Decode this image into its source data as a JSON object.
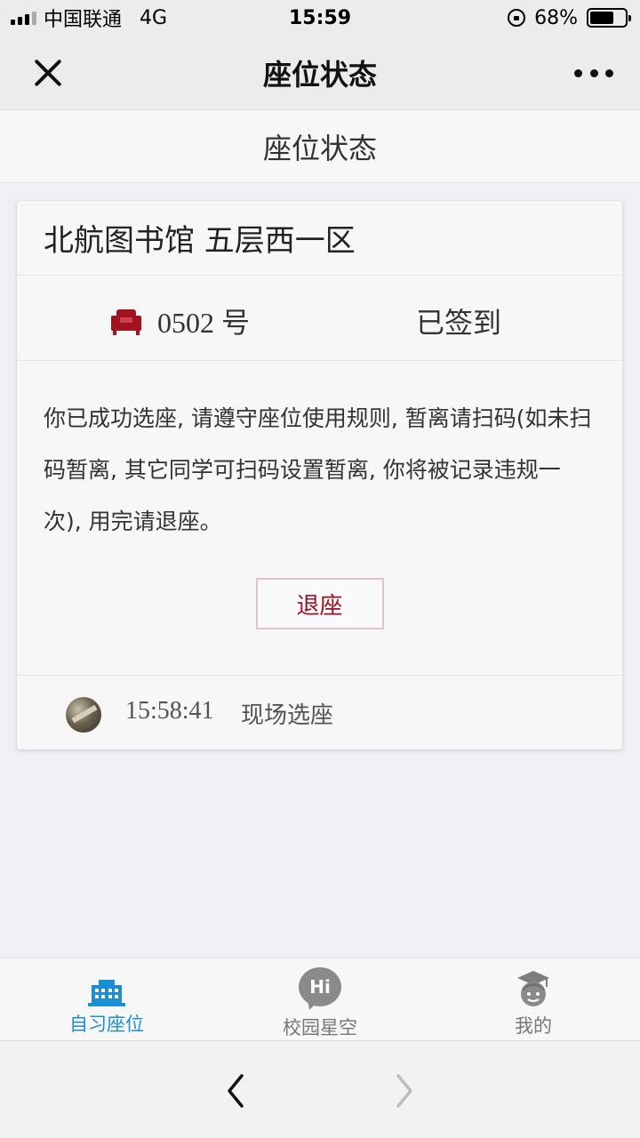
{
  "status_bar": {
    "carrier": "中国联通",
    "network": "4G",
    "time": "15:59",
    "battery": "68%",
    "battery_level": 0.68
  },
  "nav": {
    "title": "座位状态",
    "close_icon": "close-icon",
    "more_icon": "more-icon"
  },
  "page_header": {
    "title": "座位状态"
  },
  "card": {
    "location": "北航图书馆 五层西一区",
    "seat_number": "0502 号",
    "seat_status": "已签到",
    "seat_icon": "armchair-icon",
    "notice": "你已成功选座, 请遵守座位使用规则, 暂离请扫码(如未扫码暂离, 其它同学可扫码设置暂离, 你将被记录违规一次), 用完请退座。",
    "leave_button": "退座",
    "log": {
      "time": "15:58:41",
      "action": "现场选座"
    }
  },
  "tabs": [
    {
      "label": "自习座位",
      "icon": "building-icon",
      "active": true
    },
    {
      "label": "校园星空",
      "icon": "hi-chat-icon",
      "icon_text": "Hi",
      "active": false
    },
    {
      "label": "我的",
      "icon": "graduate-avatar-icon",
      "active": false
    }
  ],
  "colors": {
    "accent_active": "#1b8fd2",
    "leave_button_text": "#9a1322",
    "seat_icon": "#a3131f"
  }
}
